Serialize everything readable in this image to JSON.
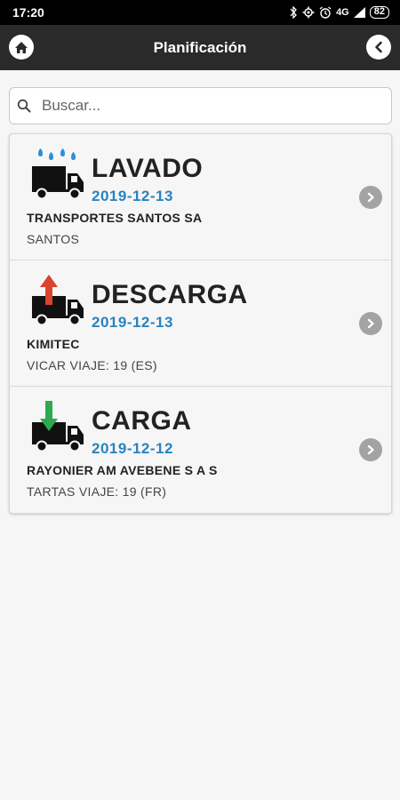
{
  "status_bar": {
    "time": "17:20",
    "network": "4G",
    "battery": "82",
    "icons": [
      "bluetooth-icon",
      "gear-icon",
      "alarm-icon",
      "signal-icon",
      "battery-icon"
    ]
  },
  "header": {
    "title": "Planificación",
    "left_icon": "home-icon",
    "right_icon": "back-icon"
  },
  "search": {
    "placeholder": "Buscar...",
    "value": ""
  },
  "items": [
    {
      "type": "LAVADO",
      "date": "2019-12-13",
      "company": "TRANSPORTES SANTOS SA",
      "detail": "SANTOS",
      "icon": "truck-wash-icon"
    },
    {
      "type": "DESCARGA",
      "date": "2019-12-13",
      "company": "KIMITEC",
      "detail": "VICAR VIAJE: 19 (ES)",
      "icon": "truck-unload-icon"
    },
    {
      "type": "CARGA",
      "date": "2019-12-12",
      "company": "RAYONIER AM AVEBENE S A S",
      "detail": "TARTAS VIAJE: 19 (FR)",
      "icon": "truck-load-icon"
    }
  ],
  "colors": {
    "date_blue": "#2a83c1",
    "water_blue": "#2e8fd6",
    "unload_red": "#d9432f",
    "load_green": "#2fa84f",
    "header_dark": "#2a2a2a"
  }
}
